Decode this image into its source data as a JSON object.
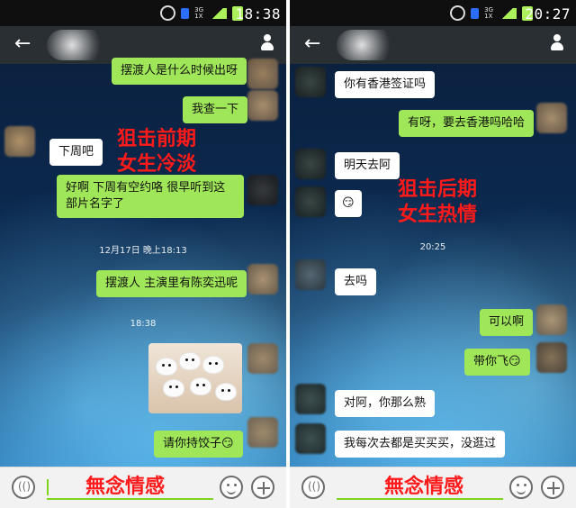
{
  "left": {
    "status": {
      "time": "18:38",
      "net_top": "3G",
      "net_bottom": "1X"
    },
    "annotation": "狙击前期\n女生冷淡",
    "messages": [
      {
        "text": "摆渡人是什么时候出呀"
      },
      {
        "text": "我查一下"
      },
      {
        "text": "下周吧"
      },
      {
        "text": "好啊 下周有空约咯 很早听到这部片名字了"
      },
      {
        "text": "摆渡人 主演里有陈奕迅呢"
      },
      {
        "text": "请你持饺子😏"
      }
    ],
    "timestamps": [
      {
        "text": "12月17日 晚上18:13"
      },
      {
        "text": "18:38"
      }
    ],
    "watermark": "無念情感"
  },
  "right": {
    "status": {
      "time": "20:27",
      "net_top": "3G",
      "net_bottom": "1X"
    },
    "annotation": "狙击后期\n女生热情",
    "messages": [
      {
        "text": "你有香港签证吗"
      },
      {
        "text": "有呀，要去香港吗哈哈"
      },
      {
        "text": "明天去阿"
      },
      {
        "text": "😏"
      },
      {
        "text": "去吗"
      },
      {
        "text": "可以啊"
      },
      {
        "text": "带你飞😏"
      },
      {
        "text": "对阿，你那么熟"
      },
      {
        "text": "我每次去都是买买买，没逛过"
      }
    ],
    "timestamps": [
      {
        "text": "20:25"
      }
    ],
    "watermark": "無念情感"
  },
  "icons": {
    "back": "back-arrow-icon",
    "profile": "profile-icon",
    "voice": "voice-icon",
    "emoji": "emoji-icon",
    "plus": "plus-icon",
    "alarm": "alarm-icon",
    "sim": "sim-icon",
    "signal": "signal-icon",
    "battery": "battery-icon"
  },
  "colors": {
    "incoming_bubble": "#ffffff",
    "outgoing_bubble": "#9fe658",
    "annotation_red": "#ff1b1b",
    "topbar": "#2a2f34",
    "statusbar": "#0f0f0f"
  }
}
